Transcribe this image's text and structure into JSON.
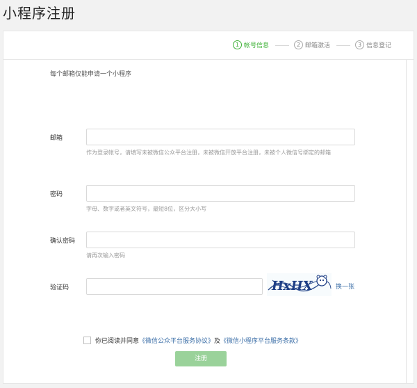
{
  "page": {
    "title": "小程序注册"
  },
  "steps": [
    {
      "num": "1",
      "label": "帐号信息"
    },
    {
      "num": "2",
      "label": "邮箱激活"
    },
    {
      "num": "3",
      "label": "信息登记"
    }
  ],
  "form": {
    "intro": "每个邮箱仅能申请一个小程序",
    "email": {
      "label": "邮箱",
      "value": "",
      "hint": "作为登录帐号，请填写未被微信公众平台注册，未被微信开放平台注册，未被个人微信号绑定的邮箱"
    },
    "password": {
      "label": "密码",
      "value": "",
      "hint": "字母、数字或者英文符号，最短8位，区分大小写"
    },
    "confirm": {
      "label": "确认密码",
      "value": "",
      "hint": "请再次输入密码"
    },
    "captcha": {
      "label": "验证码",
      "value": "",
      "image_text": "HxHX",
      "refresh": "换一张"
    },
    "agreement": {
      "prefix": "你已阅读并同意",
      "link1": "《微信公众平台服务协议》",
      "and": "及",
      "link2": "《微信小程序平台服务条款》"
    },
    "submit": "注册"
  }
}
